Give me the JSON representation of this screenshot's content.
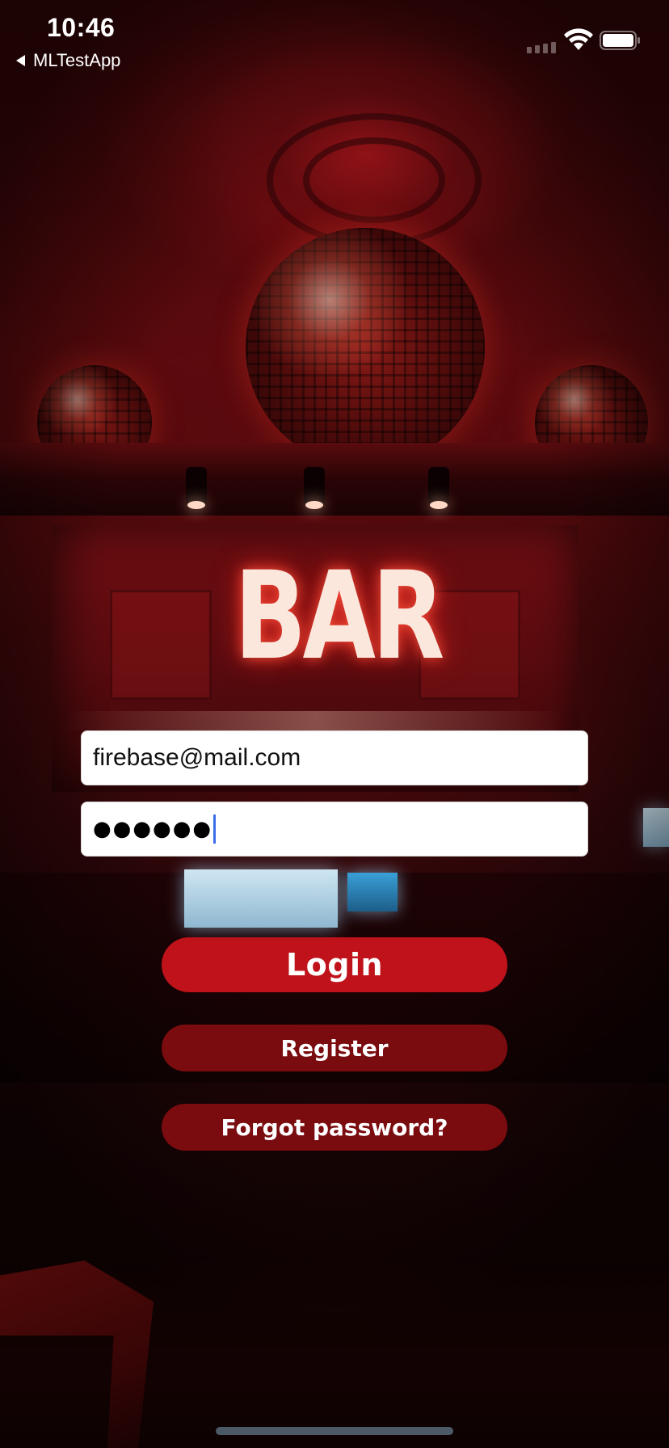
{
  "status_bar": {
    "time": "10:46",
    "back_app_label": "MLTestApp"
  },
  "background": {
    "sign_text": "BAR"
  },
  "login_form": {
    "email_value": "firebase@mail.com",
    "password_masked": "●●●●●●"
  },
  "buttons": {
    "login_label": "Login",
    "register_label": "Register",
    "forgot_label": "Forgot password?"
  },
  "colors": {
    "login_button": "#c0121a",
    "secondary_button": "#7a0b0f",
    "caret": "#3b6de8"
  }
}
